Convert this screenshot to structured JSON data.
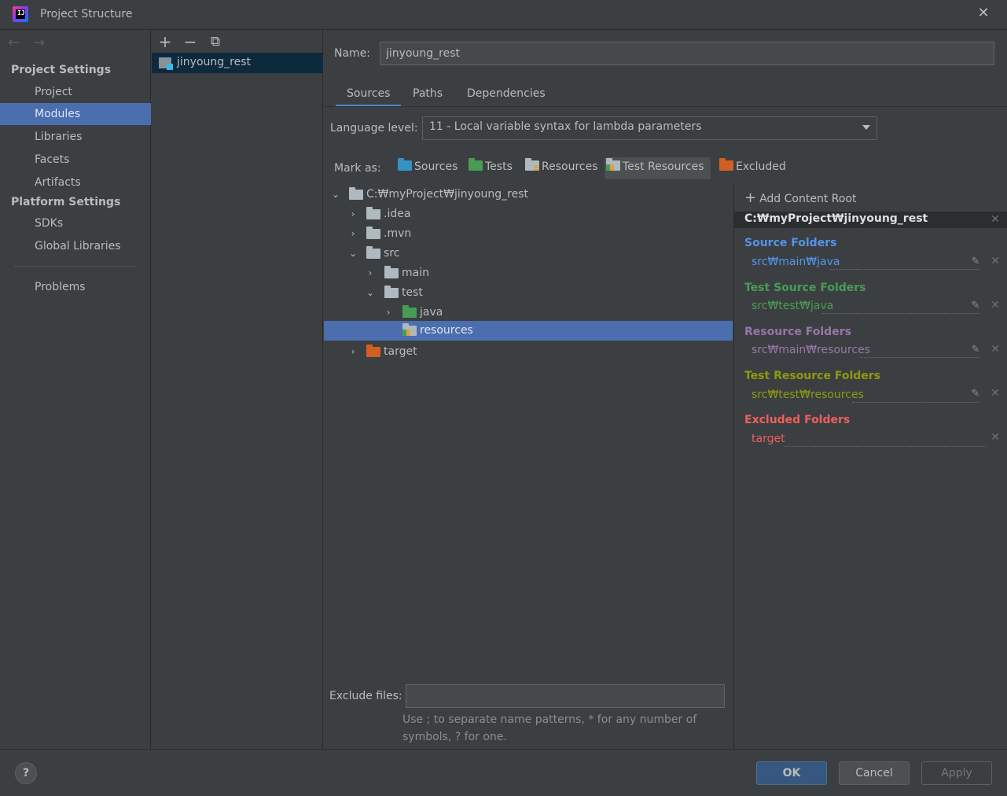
{
  "window": {
    "title": "Project Structure"
  },
  "sidebar": {
    "project_settings_header": "Project Settings",
    "project_items": [
      "Project",
      "Modules",
      "Libraries",
      "Facets",
      "Artifacts"
    ],
    "platform_settings_header": "Platform Settings",
    "platform_items": [
      "SDKs",
      "Global Libraries"
    ],
    "problems": "Problems",
    "selected": "Modules"
  },
  "modules": {
    "toolbar": {
      "add": "+",
      "remove": "−",
      "copy": "⧉"
    },
    "items": [
      "jinyoung_rest"
    ]
  },
  "module_settings": {
    "name_label": "Name:",
    "name_value": "jinyoung_rest",
    "tabs": [
      "Sources",
      "Paths",
      "Dependencies"
    ],
    "active_tab": "Sources",
    "language_level_label": "Language level:",
    "language_level_value": "11 - Local variable syntax for lambda parameters",
    "mark_as_label": "Mark as:",
    "mark_as": [
      "Sources",
      "Tests",
      "Resources",
      "Test Resources",
      "Excluded"
    ],
    "mark_as_pressed": "Test Resources",
    "tree": [
      {
        "label": "C:₩myProject₩jinyoung_rest",
        "expanded": true,
        "icon": "folder-grey"
      },
      {
        "label": ".idea",
        "expanded": false,
        "icon": "folder-grey"
      },
      {
        "label": ".mvn",
        "expanded": false,
        "icon": "folder-grey"
      },
      {
        "label": "src",
        "expanded": true,
        "icon": "folder-grey"
      },
      {
        "label": "main",
        "expanded": false,
        "icon": "folder-grey"
      },
      {
        "label": "test",
        "expanded": true,
        "icon": "folder-grey"
      },
      {
        "label": "java",
        "expanded": false,
        "icon": "folder-green"
      },
      {
        "label": "resources",
        "expanded": null,
        "icon": "folder-test-resources",
        "selected": true
      },
      {
        "label": "target",
        "expanded": false,
        "icon": "folder-orange"
      }
    ],
    "exclude_files_label": "Exclude files:",
    "exclude_files_value": "",
    "hint_line1": "Use ; to separate name patterns, * for any number of",
    "hint_line2": "symbols, ? for one."
  },
  "content_roots": {
    "add_label": "Add Content Root",
    "root_path": "C:₩myProject₩jinyoung_rest",
    "groups": [
      {
        "title": "Source Folders",
        "color": "#5394ec",
        "items": [
          "src₩main₩java"
        ],
        "editable": true
      },
      {
        "title": "Test Source Folders",
        "color": "#499c54",
        "items": [
          "src₩test₩java"
        ],
        "editable": true
      },
      {
        "title": "Resource Folders",
        "color": "#9876aa",
        "items": [
          "src₩main₩resources"
        ],
        "editable": true
      },
      {
        "title": "Test Resource Folders",
        "color": "#8c9a0f",
        "items": [
          "src₩test₩resources"
        ],
        "editable": true
      },
      {
        "title": "Excluded Folders",
        "color": "#ee5f5f",
        "items": [
          "target"
        ],
        "editable": false
      }
    ]
  },
  "footer": {
    "help": "?",
    "ok": "OK",
    "cancel": "Cancel",
    "apply": "Apply"
  }
}
